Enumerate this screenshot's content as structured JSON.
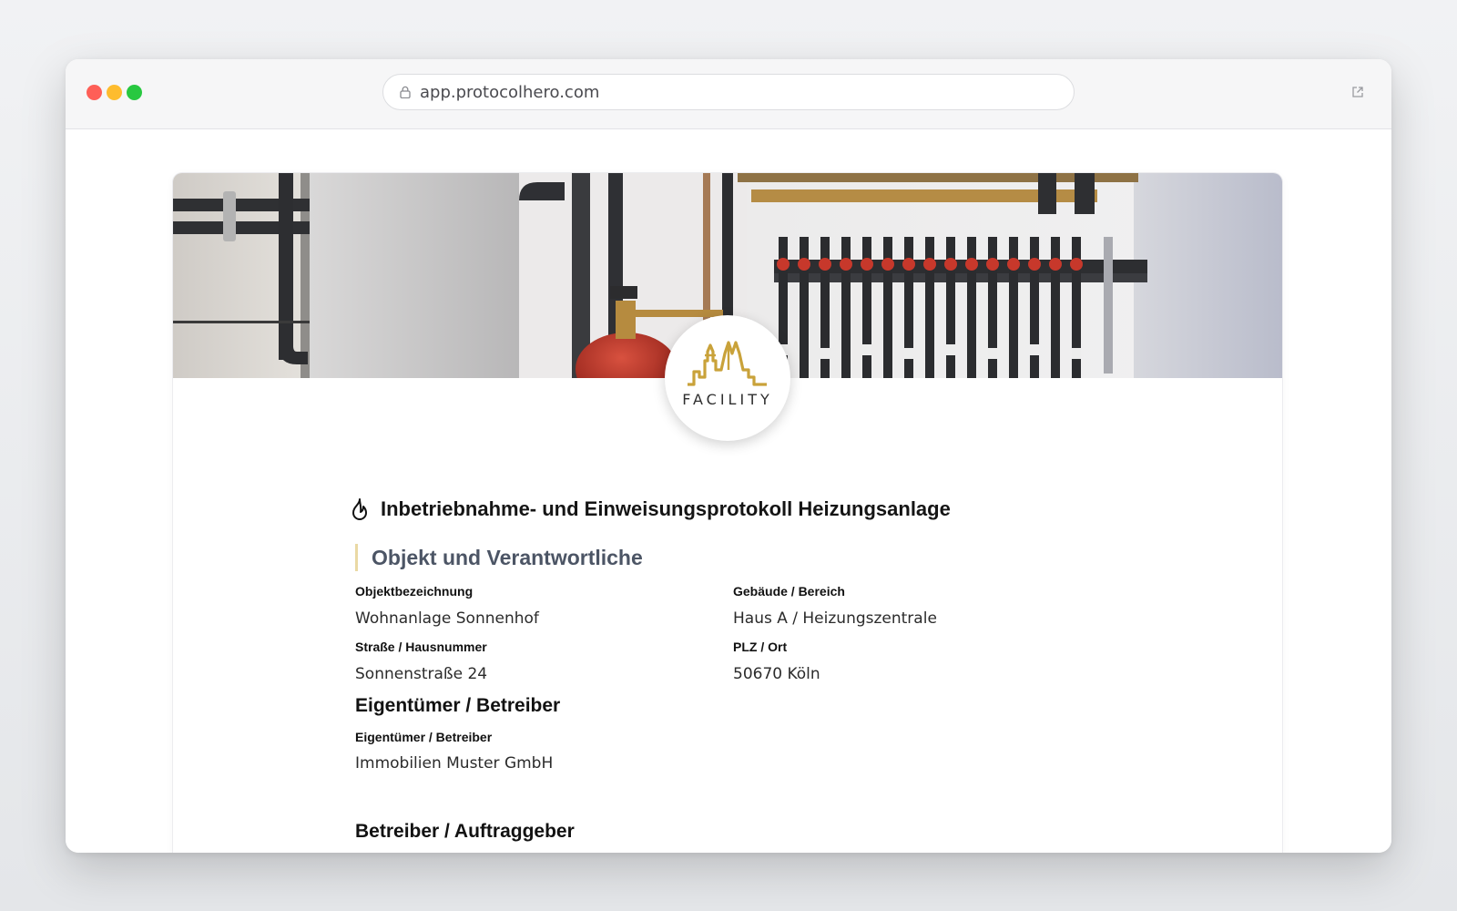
{
  "browser": {
    "url": "app.protocolhero.com",
    "colors": {
      "close": "#fe5f57",
      "minimize": "#febc2e",
      "maximize": "#28c840"
    }
  },
  "header": {
    "banner_image": "heating-system-manifold-photo",
    "logo_text": "FACILITY",
    "logo_color": "#c9a23a"
  },
  "form": {
    "title_icon": "flame-icon",
    "title": "Inbetriebnahme- und Einweisungsprotokoll Heizungsanlage",
    "section_title": "Objekt und Verantwortliche",
    "section_accent": "#ead9a4",
    "fields": [
      {
        "label": "Objektbezeichnung",
        "value": "Wohnanlage Sonnenhof"
      },
      {
        "label": "Gebäude / Bereich",
        "value": "Haus A / Heizungszentrale"
      },
      {
        "label": "Straße / Hausnummer",
        "value": "Sonnenstraße 24"
      },
      {
        "label": "PLZ / Ort",
        "value": "50670 Köln"
      }
    ],
    "owner": {
      "heading": "Eigentümer / Betreiber",
      "label": "Eigentümer / Betreiber",
      "value": "Immobilien Muster GmbH"
    },
    "operator": {
      "heading": "Betreiber / Auftraggeber"
    }
  }
}
